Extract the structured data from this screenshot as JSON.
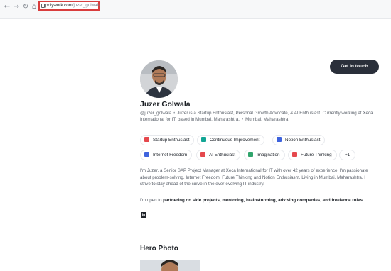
{
  "browser": {
    "back_icon": "arrow-left-icon",
    "forward_icon": "arrow-right-icon",
    "reload_icon": "reload-icon",
    "home_icon": "home-icon",
    "url_domain": "polywork.com",
    "url_path": "/juzer_golwala"
  },
  "header": {
    "cta_label": "Get in touch"
  },
  "profile": {
    "name": "Juzer Golwala",
    "handle": "@juzer_golwala",
    "headline": "Juzer is a Startup Enthusiast, Personal Growth Advocate, & AI Enthusiast. Currently working at Xeca International for IT, based in Mumbai, Maharashtra.",
    "location": "Mumbai, Maharashtra"
  },
  "tags": [
    {
      "label": "Startup Enthusiast",
      "icon": "rocket-icon",
      "color": "#e5484d"
    },
    {
      "label": "Continuous Improvement",
      "icon": "gear-icon",
      "color": "#12a594"
    },
    {
      "label": "Notion Enthusiast",
      "icon": "notion-icon",
      "color": "#3e63dd"
    },
    {
      "label": "Internet Freedom",
      "icon": "laptop-icon",
      "color": "#3e63dd"
    },
    {
      "label": "AI Enthusiast",
      "icon": "robot-icon",
      "color": "#e5484d"
    },
    {
      "label": "Imagination",
      "icon": "sparkle-icon",
      "color": "#30a46c"
    },
    {
      "label": "Future Thinking",
      "icon": "robot-icon",
      "color": "#e5484d"
    },
    {
      "label": "+1",
      "icon": "",
      "color": ""
    }
  ],
  "bio": {
    "text": "I'm Juzer, a Senior SAP Project Manager at Xeca International for IT with over 42 years of experience. I'm passionate about problem-solving, Internet Freedom, Future Thinking and Notion Enthusiasm. Living in Mumbai, Maharashtra, I strive to stay ahead of the curve in the ever-evolving IT industry.",
    "open_prefix": "I'm open to",
    "open_items": "partnering on side projects, mentoring, brainstorming, advising companies, and freelance roles."
  },
  "social": {
    "linkedin_icon": "linkedin-icon",
    "linkedin_text": "in"
  },
  "hero": {
    "title": "Hero Photo"
  }
}
